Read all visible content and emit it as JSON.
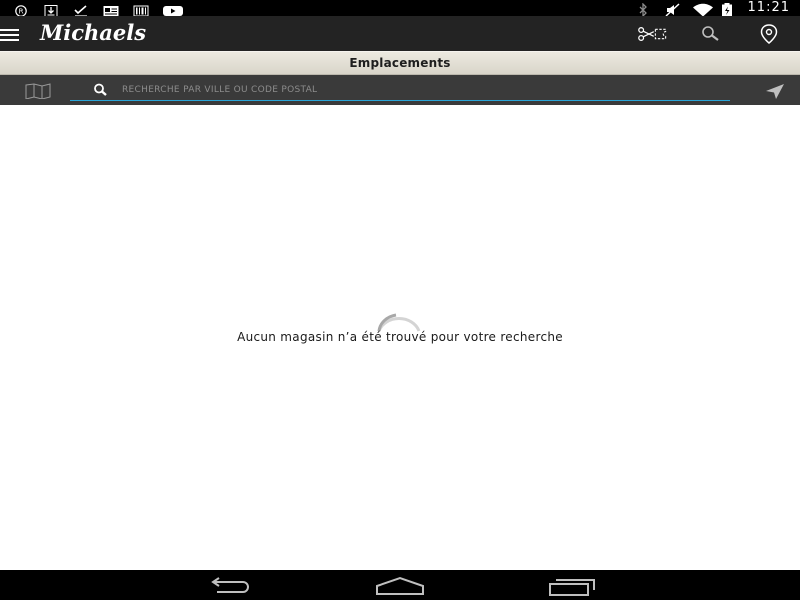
{
  "status_bar": {
    "time": "11:21",
    "left_icons": [
      "registered-icon",
      "download-icon",
      "check-icon",
      "news-icon",
      "barcode-icon",
      "youtube-icon"
    ],
    "right_icons": [
      "bluetooth-icon",
      "mute-icon",
      "wifi-icon",
      "battery-icon"
    ]
  },
  "app_bar": {
    "logo": "Michaels",
    "actions": [
      "coupon-scissors-icon",
      "search-icon",
      "store-location-icon"
    ]
  },
  "page": {
    "title": "Emplacements"
  },
  "search": {
    "placeholder": "RECHERCHE PAR VILLE OU CODE POSTAL",
    "value": "",
    "accent_color": "#2aa6d8"
  },
  "content": {
    "empty_message": "Aucun magasin n’a été trouvé pour votre recherche",
    "loading": true
  },
  "nav_bar": {
    "buttons": [
      "back-icon",
      "home-icon",
      "recents-icon"
    ]
  },
  "colors": {
    "app_bar": "#232323",
    "title_bar": "#e3e0d6",
    "search_bar": "#3a3a3a",
    "accent": "#2aa6d8"
  }
}
